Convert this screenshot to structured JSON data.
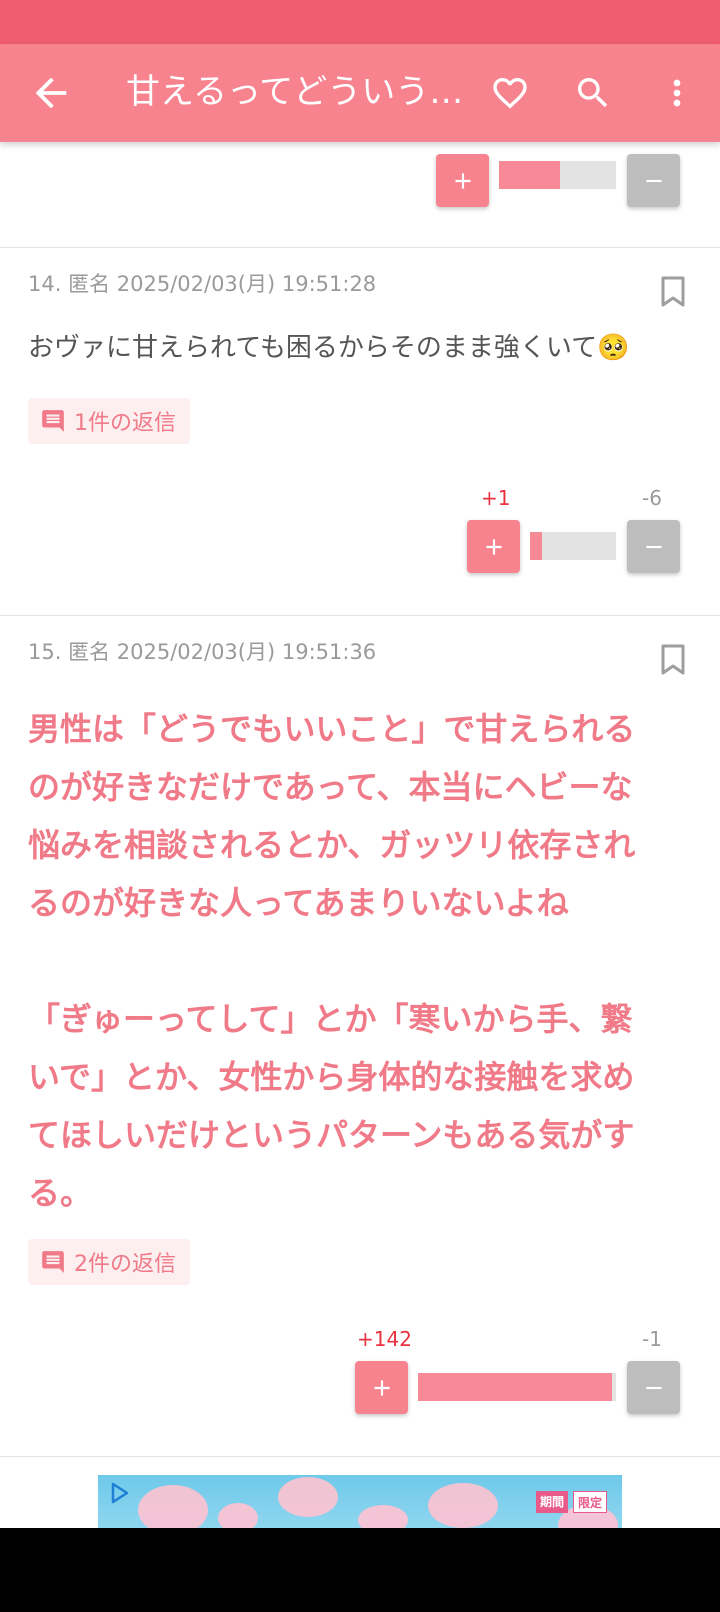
{
  "app_bar": {
    "title": "甘えるってどういう…",
    "icons": [
      "back-arrow-icon",
      "heart-icon",
      "search-icon",
      "more-vert-icon"
    ]
  },
  "prev_comment": {
    "vote_fill_ratio": 0.52
  },
  "comments": [
    {
      "meta": "14. 匿名 2025/02/03(月) 19:51:28",
      "body": "おヴァに甘えられても困るからそのまま強くいて🥺",
      "reply_label": "1件の返信",
      "plus_count": "+1",
      "minus_count": "-6",
      "vote_fill_ratio": 0.14
    },
    {
      "meta": "15. 匿名 2025/02/03(月) 19:51:36",
      "body_lines": [
        "男性は「どうでもいいこと」で甘えられる",
        "のが好きなだけであって、本当にヘビーな",
        "悩みを相談されるとか、ガッツリ依存され",
        "るのが好きな人ってあまりいないよね",
        "",
        "「ぎゅーってして」とか「寒いから手、繋",
        "いで」とか、女性から身体的な接触を求め",
        "てほしいだけというパターンもある気がす",
        "る。"
      ],
      "reply_label": "2件の返信",
      "plus_count": "+142",
      "minus_count": "-1",
      "vote_fill_ratio": 0.98
    }
  ],
  "ad": {
    "badge_1": "期間",
    "badge_2": "限定"
  },
  "colors": {
    "status_bar": "#f05c72",
    "app_bar": "#f7838f",
    "accent_text": "#f07a88",
    "plus_count": "#e8323f"
  }
}
